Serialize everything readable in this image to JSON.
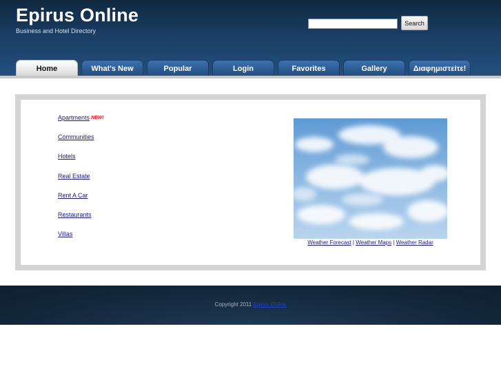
{
  "header": {
    "title": "Epirus Online",
    "subtitle": "Business and Hotel Directory"
  },
  "search": {
    "value": "",
    "button_label": "Search"
  },
  "nav": {
    "tabs": [
      {
        "label": "Home",
        "active": true
      },
      {
        "label": "What's New",
        "active": false
      },
      {
        "label": "Popular",
        "active": false
      },
      {
        "label": "Login",
        "active": false
      },
      {
        "label": "Favorites",
        "active": false
      },
      {
        "label": "Gallery",
        "active": false
      },
      {
        "label": "Διαφημιστείτε!",
        "active": false
      }
    ]
  },
  "categories": [
    {
      "label": "Apartments",
      "badge": "NEW!"
    },
    {
      "label": "Communities"
    },
    {
      "label": "Hotels"
    },
    {
      "label": "Real Estate"
    },
    {
      "label": "Rent A Car"
    },
    {
      "label": "Restaurants"
    },
    {
      "label": "Villas"
    }
  ],
  "weather": {
    "links": [
      "Weather Forecast",
      "Weather Maps",
      "Weather Radar"
    ],
    "separator": "|"
  },
  "footer": {
    "copyright_prefix": "Copyright 2011",
    "copyright_link": "Epirus Online"
  },
  "colors": {
    "header_dark": "#10283f",
    "tab_blue": "#2b5a90",
    "link": "#1a1a80",
    "badge_red": "#e0101a",
    "footer_dark": "#142a3f"
  }
}
